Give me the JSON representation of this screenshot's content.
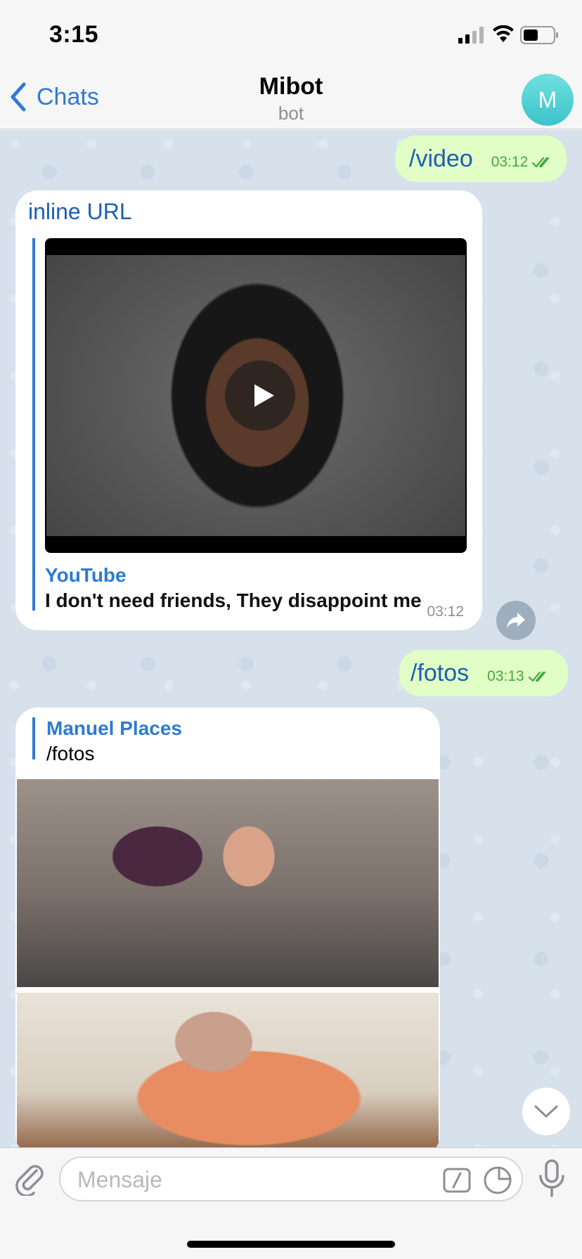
{
  "status_bar": {
    "time": "3:15"
  },
  "nav": {
    "back_label": "Chats",
    "title": "Mibot",
    "subtitle": "bot",
    "avatar_letter": "M"
  },
  "messages": [
    {
      "direction": "out",
      "text": "/video",
      "time": "03:12",
      "read": true
    },
    {
      "direction": "in",
      "text": "inline URL",
      "link_preview": {
        "site": "YouTube",
        "title": "I don't need friends, They disappoint me",
        "media": "video"
      },
      "time": "03:12"
    },
    {
      "direction": "out",
      "text": "/fotos",
      "time": "03:13",
      "read": true
    },
    {
      "direction": "in",
      "reply_to": {
        "name": "Manuel Places",
        "text": "/fotos"
      },
      "photos": 2
    }
  ],
  "input": {
    "placeholder": "Mensaje"
  },
  "colors": {
    "accent": "#2e7ad1",
    "outgoing_bubble": "#e1fec6",
    "chat_background": "#d6e1ec",
    "read_check": "#43a83f"
  },
  "icons": [
    "back-chevron-icon",
    "play-icon",
    "share-icon",
    "double-check-icon",
    "chevron-down-icon",
    "paperclip-icon",
    "slash-command-icon",
    "sticker-icon",
    "microphone-icon",
    "signal-icon",
    "wifi-icon",
    "battery-icon"
  ]
}
